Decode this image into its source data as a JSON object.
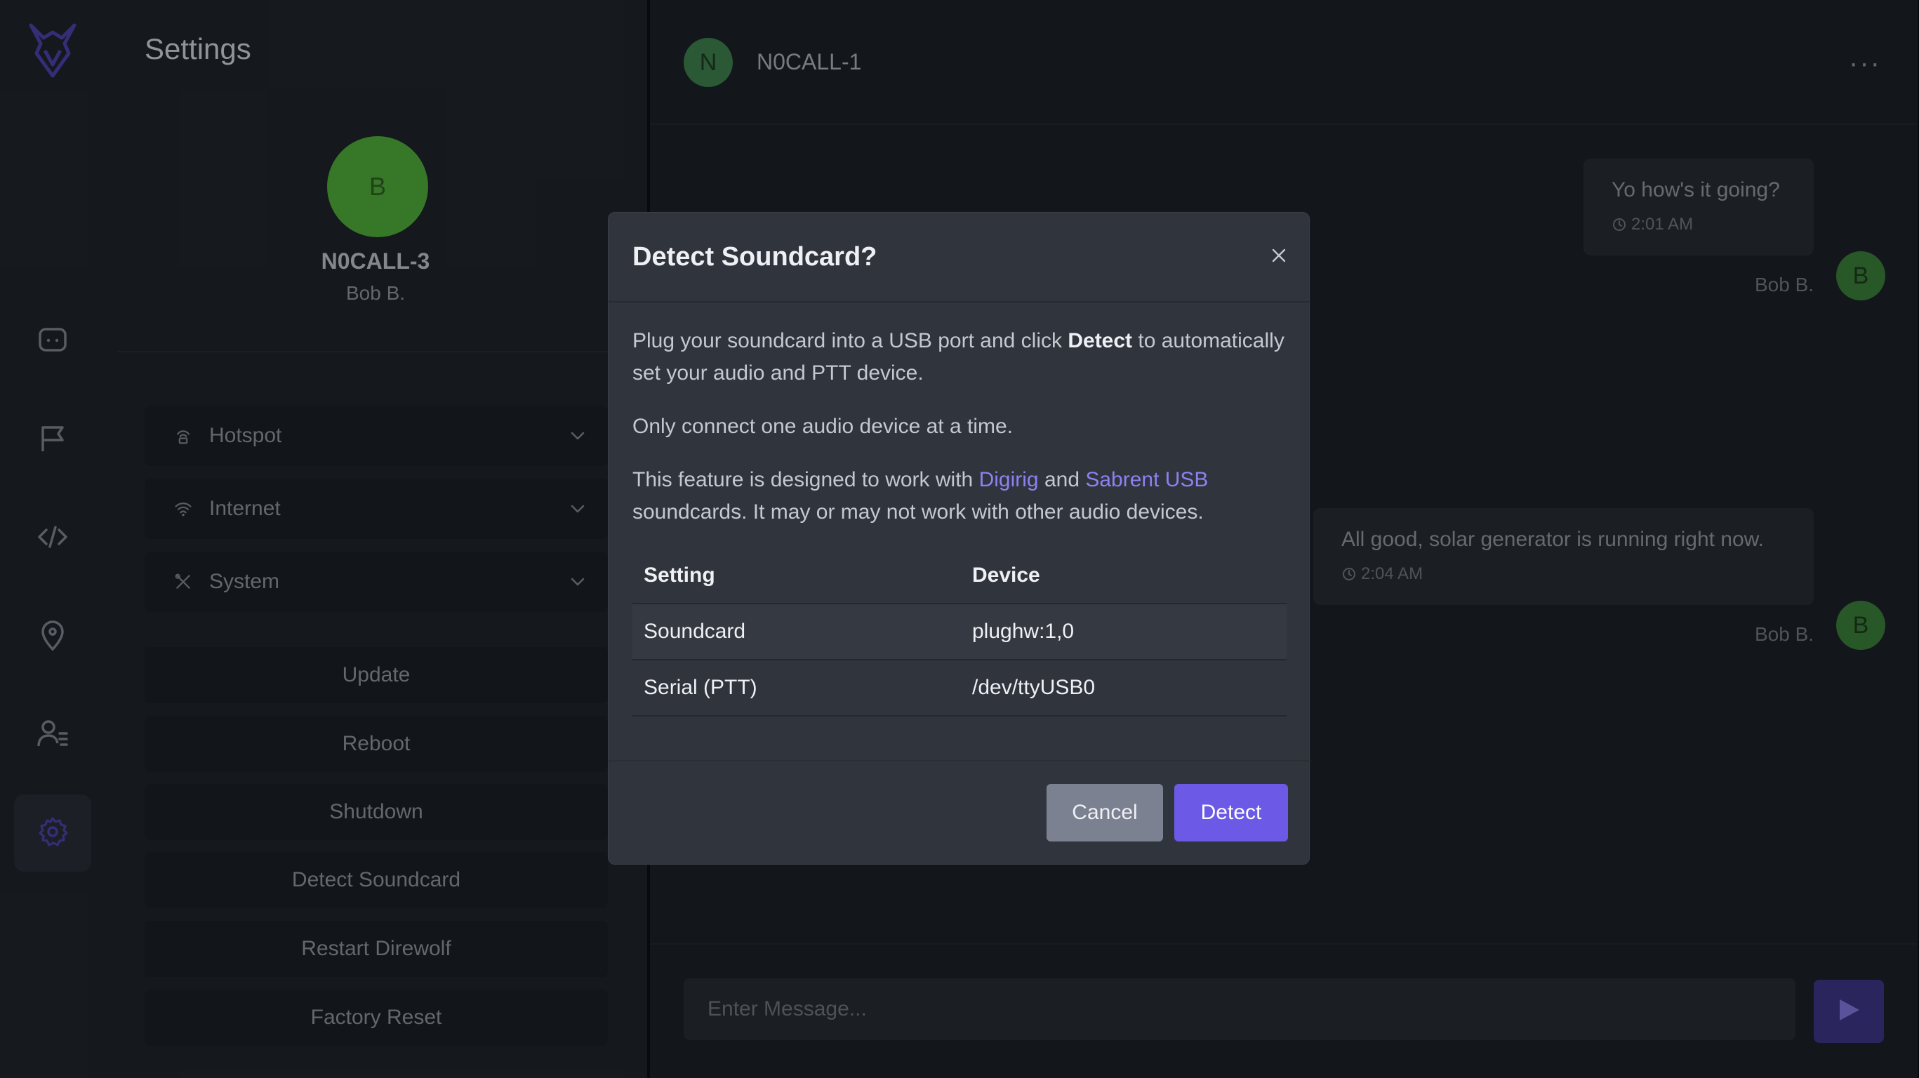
{
  "colors": {
    "accent": "#6c5ae6",
    "link": "#8b82f0",
    "avatar_green": "#4da638",
    "rail_active": "#272c35"
  },
  "rail": {
    "items": [
      {
        "name": "chat-icon",
        "active": false
      },
      {
        "name": "flag-icon",
        "active": false
      },
      {
        "name": "code-icon",
        "active": false
      },
      {
        "name": "location-pin-icon",
        "active": false
      },
      {
        "name": "contacts-icon",
        "active": false
      },
      {
        "name": "settings-gear-icon",
        "active": true
      }
    ]
  },
  "settings": {
    "title": "Settings",
    "profile": {
      "avatar_letter": "B",
      "callsign": "N0CALL-3",
      "name": "Bob B."
    },
    "sections": [
      {
        "label": "Hotspot",
        "icon": "hotspot-icon"
      },
      {
        "label": "Internet",
        "icon": "wifi-icon"
      },
      {
        "label": "System",
        "icon": "tools-icon"
      }
    ],
    "actions": [
      "Update",
      "Reboot",
      "Shutdown",
      "Detect Soundcard",
      "Restart Direwolf",
      "Factory Reset"
    ]
  },
  "chat": {
    "header": {
      "avatar_letter": "N",
      "title": "N0CALL-1",
      "more": "···"
    },
    "messages": [
      {
        "text": "Yo how's it going?",
        "time": "2:01 AM",
        "sender": "Bob B.",
        "avatar_letter": "B"
      },
      {
        "text": "All good, solar generator is running right now.",
        "time": "2:04 AM",
        "sender": "Bob B.",
        "avatar_letter": "B"
      }
    ],
    "composer": {
      "placeholder": "Enter Message..."
    }
  },
  "modal": {
    "title": "Detect Soundcard?",
    "p1_before": "Plug your soundcard into a USB port and click ",
    "p1_bold": "Detect",
    "p1_after": " to automatically set your audio and PTT device.",
    "p2": "Only connect one audio device at a time.",
    "p3_before": "This feature is designed to work with ",
    "p3_link1": "Digirig",
    "p3_mid": " and ",
    "p3_link2": "Sabrent USB",
    "p3_after": " soundcards. It may or may not work with other audio devices.",
    "table": {
      "headers": [
        "Setting",
        "Device"
      ],
      "rows": [
        [
          "Soundcard",
          "plughw:1,0"
        ],
        [
          "Serial (PTT)",
          "/dev/ttyUSB0"
        ]
      ]
    },
    "cancel_label": "Cancel",
    "detect_label": "Detect"
  }
}
